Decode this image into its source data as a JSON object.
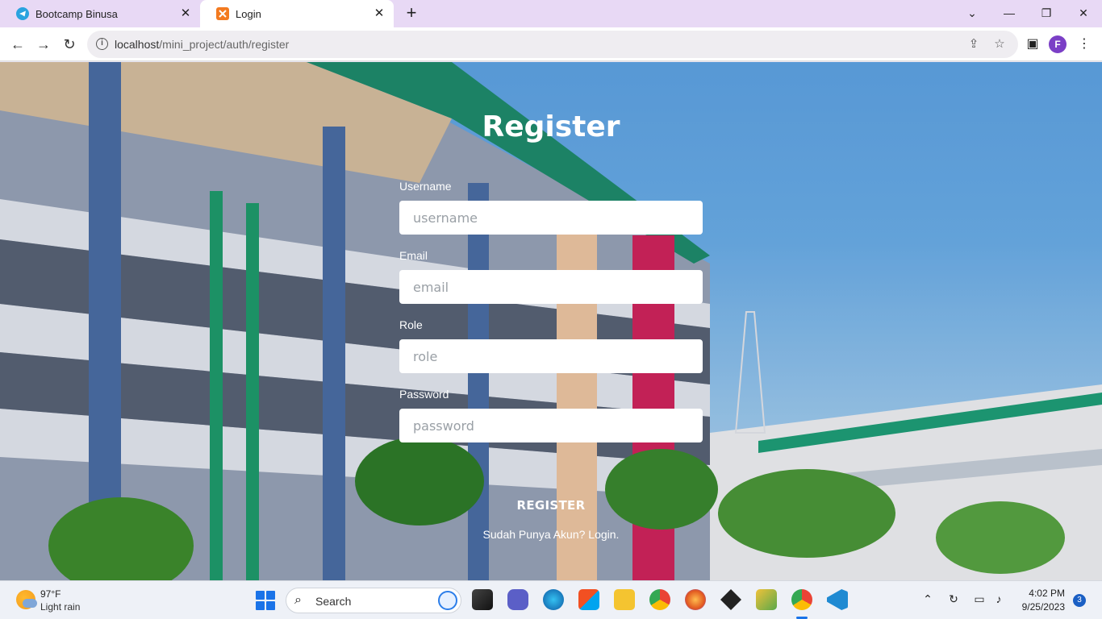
{
  "browser": {
    "tabs": [
      {
        "title": "Bootcamp Binusa",
        "icon": "telegram-icon",
        "active": false
      },
      {
        "title": "Login",
        "icon": "xampp-icon",
        "active": true
      }
    ],
    "url_host": "localhost",
    "url_path": "/mini_project/auth/register",
    "profile_initial": "F",
    "accent_color": "#7b3fc6"
  },
  "form": {
    "title": "Register",
    "fields": [
      {
        "label": "Username",
        "placeholder": "username",
        "value": ""
      },
      {
        "label": "Email",
        "placeholder": "email",
        "value": ""
      },
      {
        "label": "Role",
        "placeholder": "role",
        "value": ""
      },
      {
        "label": "Password",
        "placeholder": "password",
        "value": ""
      }
    ],
    "submit_label": "REGISTER",
    "login_prompt": "Sudah Punya Akun? Login."
  },
  "taskbar": {
    "weather_temp": "97°F",
    "weather_condition": "Light rain",
    "search_label": "Search",
    "time": "4:02 PM",
    "date": "9/25/2023",
    "notification_count": "3",
    "apps": [
      "file-explorer-icon",
      "teams-icon",
      "edge-icon",
      "store-icon",
      "folder-icon",
      "chrome-icon",
      "firefox-icon",
      "inkscape-icon",
      "app-icon",
      "chrome-profile-icon",
      "vscode-icon"
    ]
  }
}
